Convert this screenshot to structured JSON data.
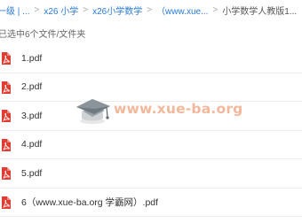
{
  "breadcrumb": {
    "items": [
      {
        "label": "一级 | ..."
      },
      {
        "label": "x26 小学"
      },
      {
        "label": "x26小学数学"
      },
      {
        "label": "（www.xue..."
      },
      {
        "label": "小学数学人教版1..."
      }
    ],
    "separator": ">"
  },
  "selection_info": "已选中6个文件/文件夹",
  "files": [
    {
      "name": "1.pdf",
      "icon": "pdf-icon"
    },
    {
      "name": "2.pdf",
      "icon": "pdf-icon"
    },
    {
      "name": "3.pdf",
      "icon": "pdf-icon"
    },
    {
      "name": "4.pdf",
      "icon": "pdf-icon"
    },
    {
      "name": "5.pdf",
      "icon": "pdf-icon"
    },
    {
      "name": "6（www.xue-ba.org 学霸网）.pdf",
      "icon": "pdf-icon"
    }
  ],
  "watermark": {
    "text": "www.xue-ba.org",
    "icon": "graduation-cap-logo"
  },
  "colors": {
    "link": "#2a7bd8",
    "pdf_red": "#e03c31",
    "watermark": "#eb8c5f"
  }
}
